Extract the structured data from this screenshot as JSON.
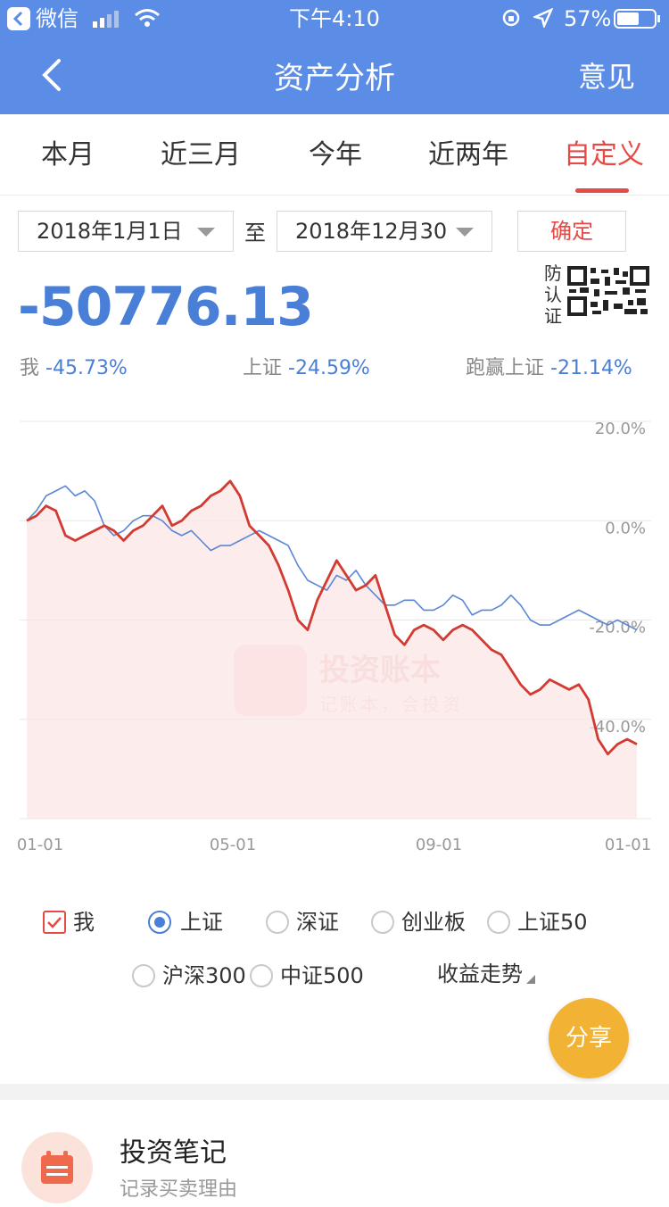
{
  "status_bar": {
    "carrier": "微信",
    "time": "下午4:10",
    "battery": "57%"
  },
  "nav": {
    "title": "资产分析",
    "right_label": "意见"
  },
  "tabs": [
    {
      "label": "本月"
    },
    {
      "label": "近三月"
    },
    {
      "label": "今年"
    },
    {
      "label": "近两年"
    },
    {
      "label": "自定义",
      "active": true
    }
  ],
  "date_range": {
    "start": "2018年1月1日",
    "separator": "至",
    "end": "2018年12月30",
    "confirm_label": "确定"
  },
  "summary": {
    "amount": "-50776.13",
    "cert_chars": [
      "防",
      "认",
      "证"
    ],
    "stats": [
      {
        "label": "我",
        "value": "-45.73%"
      },
      {
        "label": "上证",
        "value": "-24.59%"
      },
      {
        "label": "跑赢上证",
        "value": "-21.14%"
      }
    ]
  },
  "colors": {
    "primary": "#5b8de6",
    "accent": "#e64a45",
    "series_me": "#d23a32",
    "series_index": "#5a86d6",
    "share": "#f2b233"
  },
  "chart_data": {
    "type": "line",
    "x": [
      "01-01",
      "05-01",
      "09-01",
      "01-01"
    ],
    "y_ticks": [
      "20.0%",
      "0.0%",
      "-20.0%",
      "-40.0%"
    ],
    "ylim": [
      -60,
      20
    ],
    "grid": true,
    "watermark": {
      "title": "投资账本",
      "slogan": "记账本，会投资"
    },
    "series": [
      {
        "name": "我",
        "values": [
          0,
          1,
          3,
          2,
          -3,
          -4,
          -3,
          -2,
          -1,
          -2,
          -4,
          -2,
          -1,
          1,
          3,
          -1,
          0,
          2,
          3,
          5,
          6,
          8,
          5,
          -1,
          -3,
          -5,
          -9,
          -14,
          -20,
          -22,
          -16,
          -12,
          -8,
          -11,
          -14,
          -13,
          -11,
          -17,
          -23,
          -25,
          -22,
          -21,
          -22,
          -24,
          -22,
          -21,
          -22,
          -24,
          -26,
          -27,
          -30,
          -33,
          -35,
          -34,
          -32,
          -33,
          -34,
          -33,
          -36,
          -44,
          -47,
          -45,
          -44,
          -45
        ]
      },
      {
        "name": "上证",
        "values": [
          0,
          2,
          5,
          6,
          7,
          5,
          6,
          4,
          -1,
          -3,
          -2,
          0,
          1,
          1,
          0,
          -2,
          -3,
          -2,
          -4,
          -6,
          -5,
          -5,
          -4,
          -3,
          -2,
          -3,
          -4,
          -5,
          -9,
          -12,
          -13,
          -14,
          -11,
          -12,
          -10,
          -13,
          -15,
          -17,
          -17,
          -16,
          -16,
          -18,
          -18,
          -17,
          -15,
          -16,
          -19,
          -18,
          -18,
          -17,
          -15,
          -17,
          -20,
          -21,
          -21,
          -20,
          -19,
          -18,
          -19,
          -20,
          -21,
          -20,
          -21,
          -22
        ]
      }
    ]
  },
  "compare": {
    "row1": [
      {
        "label": "我",
        "state": "checked"
      },
      {
        "label": "上证",
        "state": "selected"
      },
      {
        "label": "深证",
        "state": "off"
      },
      {
        "label": "创业板",
        "state": "off"
      },
      {
        "label": "上证50",
        "state": "off"
      }
    ],
    "row2": [
      {
        "label": "沪深300",
        "state": "off"
      },
      {
        "label": "中证500",
        "state": "off"
      }
    ],
    "trend_label": "收益走势"
  },
  "share_label": "分享",
  "notes_card": {
    "title": "投资笔记",
    "subtitle": "记录买卖理由"
  }
}
